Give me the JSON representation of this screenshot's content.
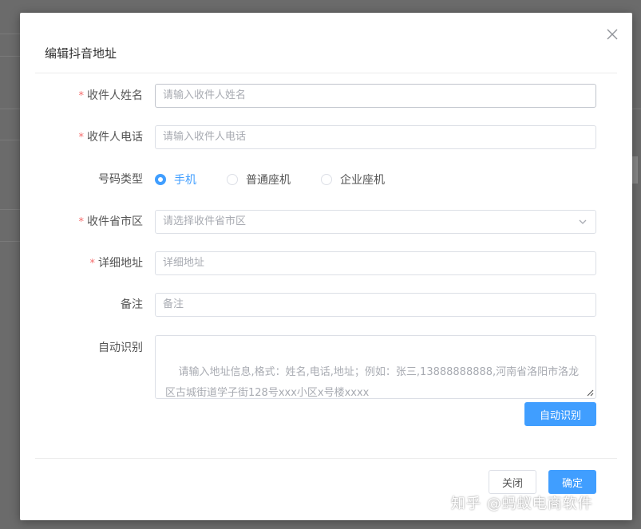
{
  "dialog": {
    "title": "编辑抖音地址",
    "close_icon": "close-icon"
  },
  "form": {
    "name": {
      "label": "收件人姓名",
      "required": true,
      "placeholder": "请输入收件人姓名",
      "value": ""
    },
    "phone": {
      "label": "收件人电话",
      "required": true,
      "placeholder": "请输入收件人电话",
      "value": ""
    },
    "phone_type": {
      "label": "号码类型",
      "options": [
        "手机",
        "普通座机",
        "企业座机"
      ],
      "selected": "手机"
    },
    "region": {
      "label": "收件省市区",
      "required": true,
      "placeholder": "请选择收件省市区",
      "icon": "chevron-down-icon"
    },
    "address": {
      "label": "详细地址",
      "required": true,
      "placeholder": "详细地址",
      "value": ""
    },
    "remark": {
      "label": "备注",
      "required": false,
      "placeholder": "备注",
      "value": ""
    },
    "auto_recognize": {
      "label": "自动识别",
      "placeholder": "请输入地址信息,格式：姓名,电话,地址；例如：张三,13888888888,河南省洛阳市洛龙区古城街道学子街128号xxx小区x号楼xxxx"
    }
  },
  "buttons": {
    "auto_recognize": "自动识别",
    "cancel": "关闭",
    "confirm": "确定"
  },
  "watermark": "知乎 @蚂蚁电商软件",
  "colors": {
    "primary": "#409eff",
    "required": "#f56c6c",
    "border": "#dcdfe6",
    "placeholder": "#a8abb2"
  }
}
